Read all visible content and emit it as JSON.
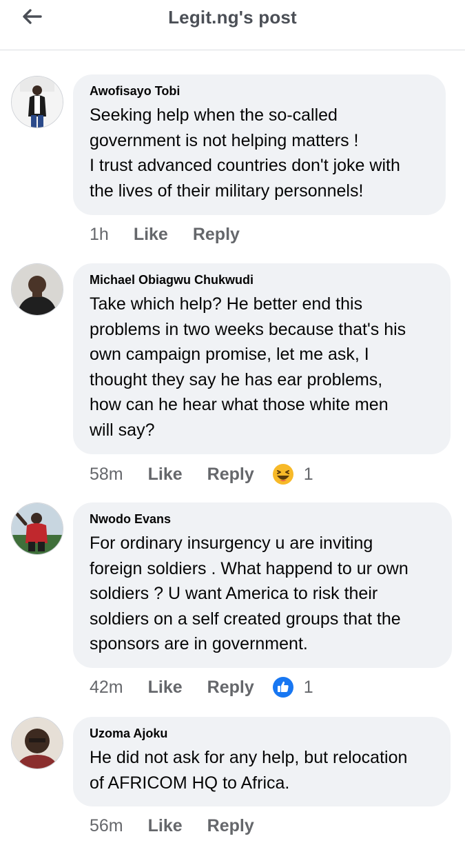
{
  "header": {
    "title": "Legit.ng's post"
  },
  "comments": [
    {
      "author": "Awofisayo Tobi",
      "text": "Seeking help when the so-called\ngovernment is not helping matters !\nI trust advanced countries don't joke with\nthe lives of their military personnels!",
      "time": "1h",
      "like": "Like",
      "reply": "Reply"
    },
    {
      "author": "Michael Obiagwu Chukwudi",
      "text": "Take which help? He better end this\nproblems in two weeks because that's his\nown campaign promise, let me ask, I\nthought they say he has ear problems,\nhow can he hear what those white men\nwill say?",
      "time": "58m",
      "like": "Like",
      "reply": "Reply",
      "reaction": {
        "icon": "haha-emoji-icon",
        "count": "1"
      }
    },
    {
      "author": "Nwodo Evans",
      "text": "For ordinary insurgency u are inviting\nforeign soldiers . What happend to ur own\nsoldiers ? U want America to risk their\nsoldiers on a self created groups that the\nsponsors are in government.",
      "time": "42m",
      "like": "Like",
      "reply": "Reply",
      "reaction": {
        "icon": "like-thumb-icon",
        "count": "1"
      }
    },
    {
      "author": "Uzoma Ajoku",
      "text": "He did not ask for any help, but relocation\nof AFRICOM HQ  to Africa.",
      "time": "56m",
      "like": "Like",
      "reply": "Reply"
    }
  ],
  "colors": {
    "bubble": "#f0f2f5",
    "meta": "#65676b",
    "like_blue": "#1877f2",
    "haha_yellow": "#f7b928"
  }
}
